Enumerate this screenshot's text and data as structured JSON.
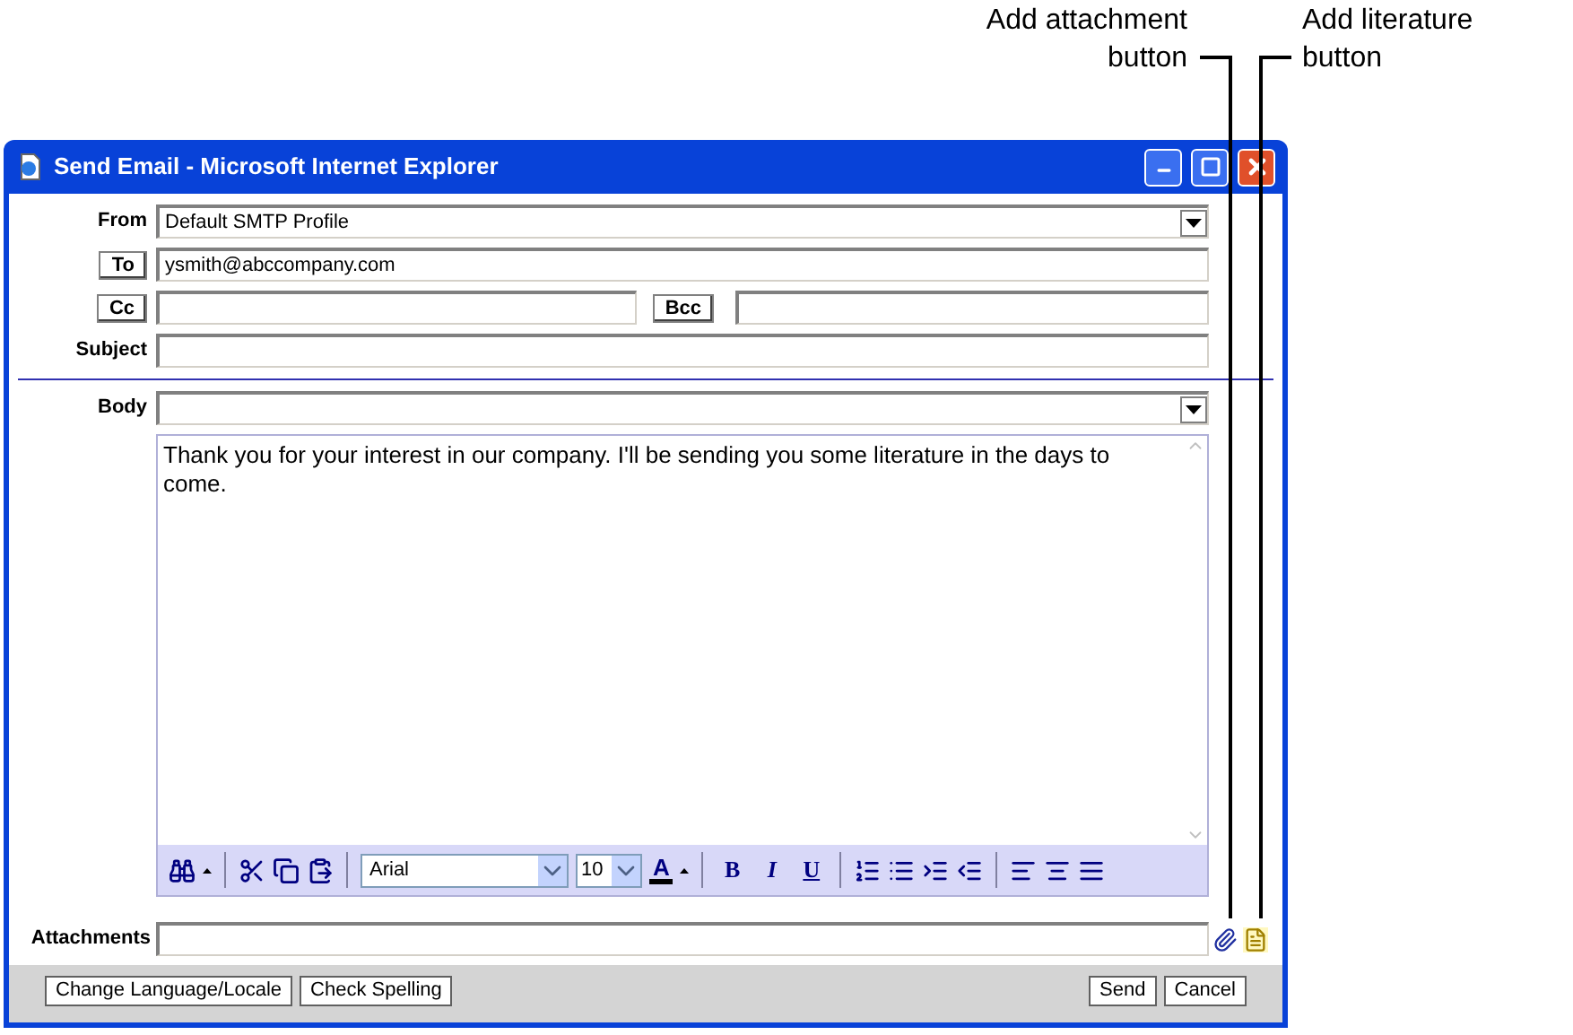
{
  "callouts": [
    {
      "label": "Add attachment button"
    },
    {
      "label": "Add literature button"
    }
  ],
  "window": {
    "title": "Send Email - Microsoft Internet Explorer"
  },
  "form": {
    "from": {
      "label": "From",
      "value": "Default SMTP Profile"
    },
    "to": {
      "button": "To",
      "value": "ysmith@abccompany.com"
    },
    "cc": {
      "button": "Cc"
    },
    "bcc": {
      "button": "Bcc"
    },
    "subject": {
      "label": "Subject"
    },
    "body": {
      "label": "Body",
      "text": "Thank you for your interest in our company. I'll be sending you some literature in the days to come."
    },
    "toolbar": {
      "font": "Arial",
      "size": "10",
      "font_color": "A",
      "styles": [
        {
          "text": "B",
          "kind": "bold"
        },
        {
          "text": "I",
          "kind": "italic"
        },
        {
          "text": "U",
          "kind": "underline"
        }
      ]
    },
    "attachments": {
      "label": "Attachments"
    }
  },
  "footer": {
    "left_buttons": [
      "Change Language/Locale",
      "Check Spelling"
    ],
    "right_buttons": [
      "Send",
      "Cancel"
    ]
  }
}
